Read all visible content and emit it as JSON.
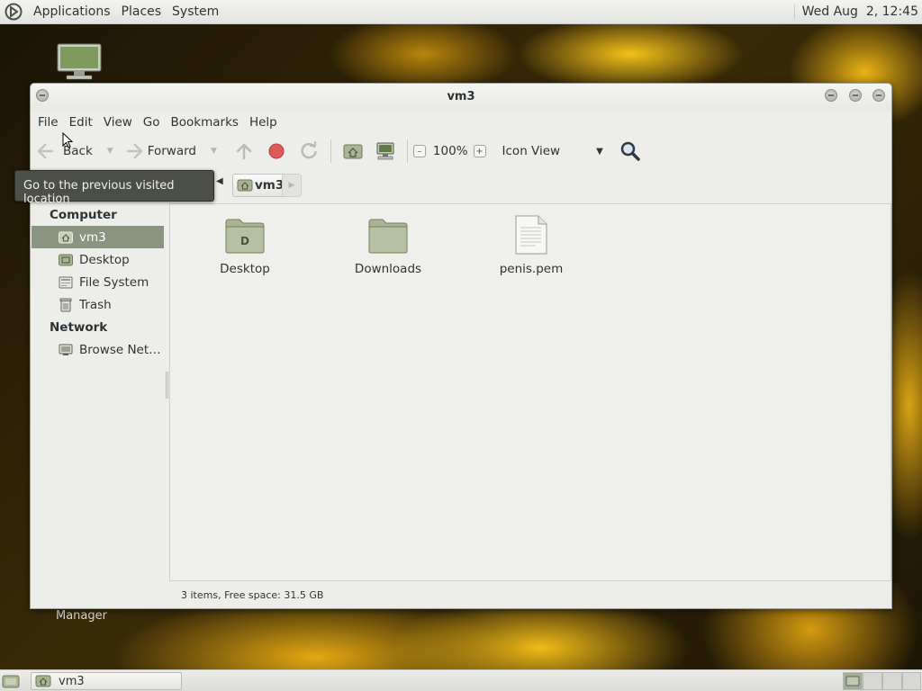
{
  "top_panel": {
    "menus": [
      "Applications",
      "Places",
      "System"
    ],
    "clock": "Wed Aug  2, 12:45"
  },
  "desktop": {
    "icon_label_partial": "Manager"
  },
  "window": {
    "title": "vm3",
    "menubar": [
      "File",
      "Edit",
      "View",
      "Go",
      "Bookmarks",
      "Help"
    ],
    "toolbar": {
      "back_label": "Back",
      "forward_label": "Forward",
      "zoom_level": "100%",
      "view_mode": "Icon View"
    },
    "tooltip": "Go to the previous visited location",
    "location": {
      "current": "vm3"
    },
    "sidebar": {
      "sections": [
        {
          "heading": "Computer",
          "items": [
            {
              "label": "vm3",
              "icon": "home-folder-icon",
              "selected": true
            },
            {
              "label": "Desktop",
              "icon": "desktop-folder-icon",
              "selected": false
            },
            {
              "label": "File System",
              "icon": "drive-icon",
              "selected": false
            },
            {
              "label": "Trash",
              "icon": "trash-icon",
              "selected": false
            }
          ]
        },
        {
          "heading": "Network",
          "items": [
            {
              "label": "Browse Net…",
              "icon": "network-icon",
              "selected": false
            }
          ]
        }
      ]
    },
    "files": [
      {
        "name": "Desktop",
        "type": "folder-desktop"
      },
      {
        "name": "Downloads",
        "type": "folder"
      },
      {
        "name": "penis.pem",
        "type": "text-file"
      }
    ],
    "status": "3 items, Free space: 31.5 GB"
  },
  "bottom_panel": {
    "task_label": "vm3"
  },
  "colors": {
    "selection": "#8a9580",
    "folder": "#a9b493",
    "panel": "#e3e4df"
  }
}
